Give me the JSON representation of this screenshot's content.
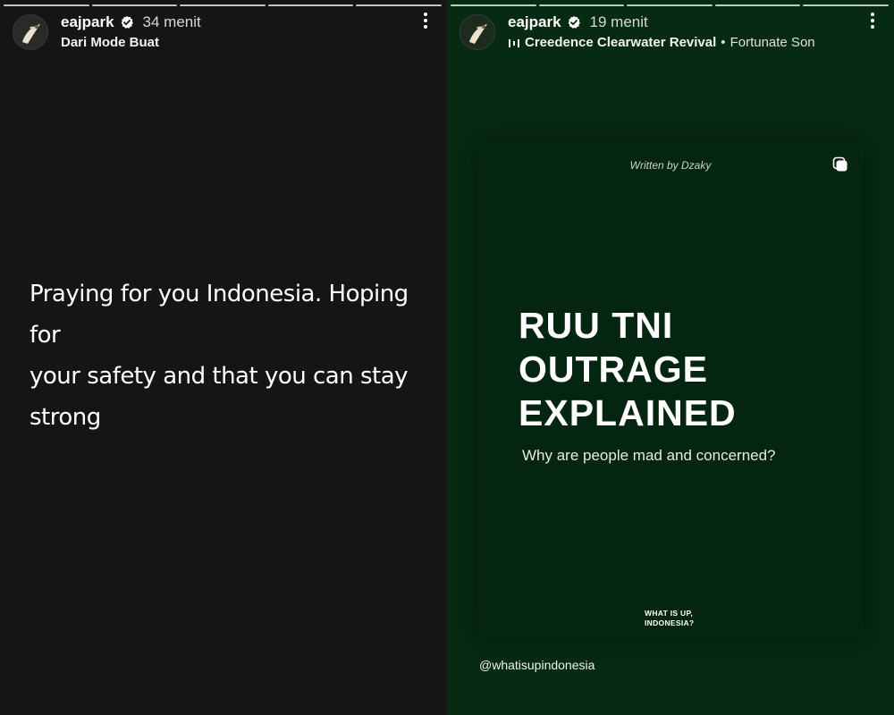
{
  "left_story": {
    "username": "eajpark",
    "time": "34 menit",
    "subtitle": "Dari Mode Buat",
    "text_lines": [
      "Praying for you Indonesia. Hoping for",
      "your safety and that you can stay",
      "strong"
    ],
    "progress_segments": 5
  },
  "right_story": {
    "username": "eajpark",
    "time": "19 menit",
    "music": {
      "artist": "Creedence Clearwater Revival",
      "separator": "•",
      "song": "Fortunate Son"
    },
    "card": {
      "written_by": "Written by Dzaky",
      "title_lines": [
        "RUU TNI",
        "OUTRAGE",
        "EXPLAINED"
      ],
      "subheading": "Why are people mad and concerned?",
      "brand_lines": [
        "WHAT IS UP,",
        "INDONESIA?"
      ]
    },
    "handle": "@whatisupindonesia",
    "progress_segments": 5
  },
  "colors": {
    "left_background": "#151515",
    "right_background": "#062a12",
    "card_background": "#042510",
    "verified_badge": "#ffffff"
  },
  "icons": {
    "verified": "verified-badge-icon",
    "music": "music-bars-icon",
    "more": "more-vertical-icon",
    "copy": "multiple-posts-icon"
  }
}
